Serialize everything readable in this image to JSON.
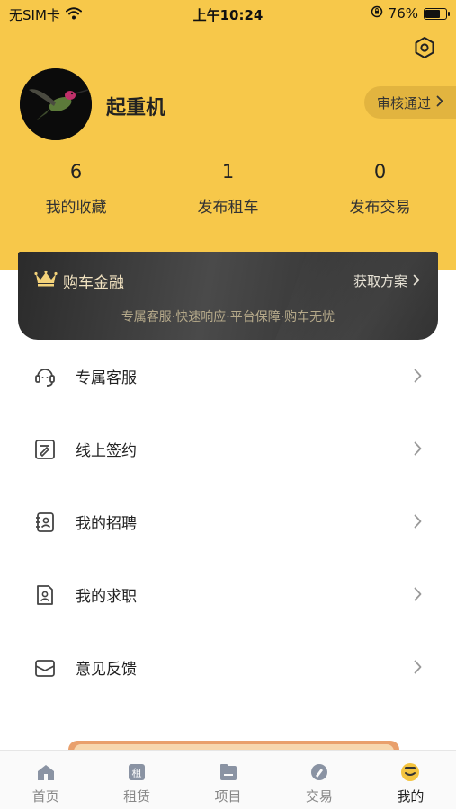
{
  "status_bar": {
    "carrier": "无SIM卡",
    "time": "上午10:24",
    "battery": "76%",
    "battery_level": 0.76
  },
  "profile": {
    "name": "起重机",
    "review_status": "审核通过"
  },
  "stats": [
    {
      "value": "6",
      "label": "我的收藏"
    },
    {
      "value": "1",
      "label": "发布租车"
    },
    {
      "value": "0",
      "label": "发布交易"
    }
  ],
  "finance": {
    "title": "购车金融",
    "action": "获取方案",
    "subtitle": "专属客服·快速响应·平台保障·购车无忧"
  },
  "menu": [
    {
      "label": "专属客服",
      "icon": "headset-icon"
    },
    {
      "label": "线上签约",
      "icon": "sign-document-icon"
    },
    {
      "label": "我的招聘",
      "icon": "contact-book-icon"
    },
    {
      "label": "我的求职",
      "icon": "resume-icon"
    },
    {
      "label": "意见反馈",
      "icon": "envelope-icon"
    }
  ],
  "tabbar": [
    {
      "label": "首页",
      "icon": "home-icon"
    },
    {
      "label": "租赁",
      "icon": "rent-icon",
      "icon_text": "租"
    },
    {
      "label": "项目",
      "icon": "project-icon"
    },
    {
      "label": "交易",
      "icon": "trade-icon"
    },
    {
      "label": "我的",
      "icon": "profile-face-icon",
      "active": true
    }
  ],
  "colors": {
    "header_yellow": "#f7c84a",
    "accent_gold": "#e2b43f",
    "card_dark": "#3a3a3a",
    "card_text_gold": "#f1e2c0"
  }
}
